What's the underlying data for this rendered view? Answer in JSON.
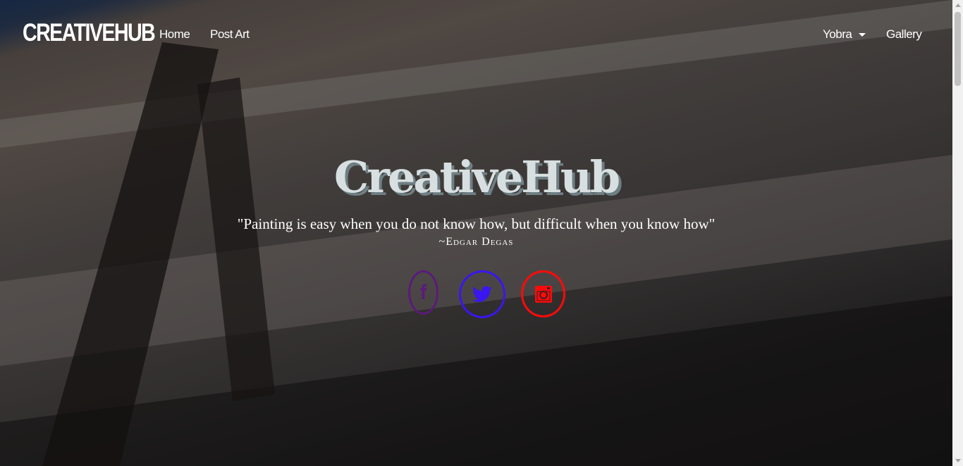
{
  "nav": {
    "brand": "CREATIVEHUB",
    "links": [
      "Home",
      "Post Art"
    ],
    "user": "Yobra",
    "gallery": "Gallery"
  },
  "hero": {
    "title": "CreativeHub",
    "quote": "\"Painting is easy when you do not know how, but difficult when you know how\"",
    "author": "~Edgar Degas"
  },
  "social": [
    {
      "icon": "facebook-icon",
      "glyph": "f",
      "color": "#5b1a7a"
    },
    {
      "icon": "twitter-icon",
      "glyph": "🐦",
      "color": "#3a16f0"
    },
    {
      "icon": "instagram-icon",
      "glyph": "◙",
      "color": "#ff0a0a"
    }
  ]
}
